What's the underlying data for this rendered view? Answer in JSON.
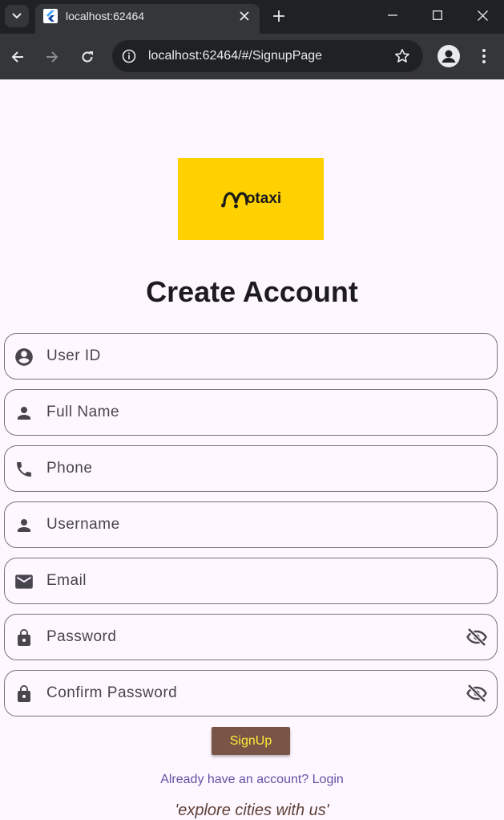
{
  "browser": {
    "tab_title": "localhost:62464",
    "url": "localhost:62464/#/SignupPage",
    "icons": {
      "tab_menu": "chevron-down-icon",
      "favicon": "flutter-icon",
      "tab_close": "close-icon",
      "new_tab": "plus-icon",
      "minimize": "minimize-icon",
      "maximize": "maximize-icon",
      "close_window": "close-icon",
      "back": "arrow-left-icon",
      "forward": "arrow-right-icon",
      "reload": "reload-icon",
      "site_info": "info-icon",
      "bookmark": "star-icon",
      "profile": "profile-icon",
      "menu": "more-vert-icon"
    }
  },
  "page": {
    "logo_text": "otaxi",
    "title": "Create Account",
    "fields": [
      {
        "placeholder": "User ID",
        "icon": "account-circle-icon"
      },
      {
        "placeholder": "Full Name",
        "icon": "person-icon"
      },
      {
        "placeholder": "Phone",
        "icon": "phone-icon"
      },
      {
        "placeholder": "Username",
        "icon": "person-icon"
      },
      {
        "placeholder": "Email",
        "icon": "mail-icon"
      },
      {
        "placeholder": "Password",
        "icon": "lock-icon",
        "trailing_icon": "visibility-off-icon"
      },
      {
        "placeholder": "Confirm Password",
        "icon": "lock-icon",
        "trailing_icon": "visibility-off-icon"
      }
    ],
    "signup_label": "SignUp",
    "login_link": "Already have an account? Login",
    "tagline": "'explore cities with us'"
  },
  "colors": {
    "background": "#fef7ff",
    "logo_background": "#ffd100",
    "signup_button": "#795548",
    "signup_text": "#ffeb3b",
    "link": "#6750a4",
    "tagline": "#5d4037",
    "field_border": "#79747e"
  }
}
